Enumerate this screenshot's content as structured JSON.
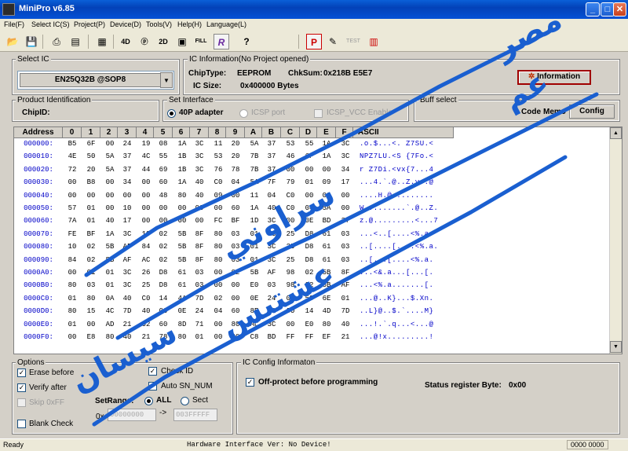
{
  "window": {
    "title": "MiniPro v6.85"
  },
  "menu": [
    "File(F)",
    "Select IC(S)",
    "Project(P)",
    "Device(D)",
    "Tools(V)",
    "Help(H)",
    "Language(L)"
  ],
  "select_ic": {
    "label": "Select IC",
    "chip": "EN25Q32B @SOP8"
  },
  "ic_info": {
    "label": "IC Information(No Project opened)",
    "chiptype_label": "ChipType:",
    "chiptype": "EEPROM",
    "chksum_label": "ChkSum:",
    "chksum": "0x218B E5E7",
    "icsize_label": "IC Size:",
    "icsize": "0x400000 Bytes",
    "info_button": "Information"
  },
  "product_id": {
    "label": "Product Identification",
    "chipid_label": "ChipID:"
  },
  "interface": {
    "label": "Set Interface",
    "opt40p": "40P adapter",
    "icsp": "ICSP port",
    "icspvcc": "ICSP_VCC Enable"
  },
  "buff": {
    "label": "Buff select",
    "code": "Code",
    "memo": "Memo",
    "config": "Config"
  },
  "grid": {
    "headers": [
      "Address",
      "0",
      "1",
      "2",
      "3",
      "4",
      "5",
      "6",
      "7",
      "8",
      "9",
      "A",
      "B",
      "C",
      "D",
      "E",
      "F",
      "ASCII"
    ],
    "rows": [
      {
        "addr": "000000:",
        "bytes": [
          "B5",
          "6F",
          "00",
          "24",
          "19",
          "08",
          "1A",
          "3C",
          "11",
          "20",
          "5A",
          "37",
          "53",
          "55",
          "1A",
          "3C"
        ],
        "ascii": ".o.$...<. Z7SU.<"
      },
      {
        "addr": "000010:",
        "bytes": [
          "4E",
          "50",
          "5A",
          "37",
          "4C",
          "55",
          "1B",
          "3C",
          "53",
          "20",
          "7B",
          "37",
          "46",
          "6F",
          "1A",
          "3C"
        ],
        "ascii": "NPZ7LU.<S {7Fo.<"
      },
      {
        "addr": "000020:",
        "bytes": [
          "72",
          "20",
          "5A",
          "37",
          "44",
          "69",
          "1B",
          "3C",
          "76",
          "78",
          "7B",
          "37",
          "00",
          "00",
          "00",
          "34"
        ],
        "ascii": "r Z7Di.<vx{7...4"
      },
      {
        "addr": "000030:",
        "bytes": [
          "00",
          "B8",
          "00",
          "34",
          "00",
          "60",
          "1A",
          "40",
          "C0",
          "04",
          "5A",
          "7F",
          "79",
          "01",
          "09",
          "17"
        ],
        "ascii": "...4.`.@..Z.y..@"
      },
      {
        "addr": "000040:",
        "bytes": [
          "00",
          "00",
          "00",
          "00",
          "00",
          "48",
          "80",
          "40",
          "09",
          "00",
          "11",
          "04",
          "C0",
          "00",
          "00",
          "00"
        ],
        "ascii": "....H.@........."
      },
      {
        "addr": "000050:",
        "bytes": [
          "57",
          "01",
          "00",
          "10",
          "00",
          "00",
          "00",
          "00",
          "00",
          "60",
          "1A",
          "40",
          "C0",
          "04",
          "5A",
          "00"
        ],
        "ascii": "W.........`.@..Z."
      },
      {
        "addr": "000060:",
        "bytes": [
          "7A",
          "01",
          "40",
          "17",
          "00",
          "00",
          "00",
          "00",
          "FC",
          "BF",
          "1D",
          "3C",
          "00",
          "0E",
          "BD",
          "37"
        ],
        "ascii": "z.@.........<...7"
      },
      {
        "addr": "000070:",
        "bytes": [
          "FE",
          "BF",
          "1A",
          "3C",
          "10",
          "02",
          "5B",
          "8F",
          "80",
          "03",
          "01",
          "3C",
          "25",
          "D8",
          "61",
          "03"
        ],
        "ascii": "...<..[....<%.a."
      },
      {
        "addr": "000080:",
        "bytes": [
          "10",
          "02",
          "5B",
          "AF",
          "84",
          "02",
          "5B",
          "8F",
          "80",
          "03",
          "01",
          "3C",
          "25",
          "D8",
          "61",
          "03"
        ],
        "ascii": "..[....[....<%.a."
      },
      {
        "addr": "000090:",
        "bytes": [
          "84",
          "02",
          "5B",
          "AF",
          "AC",
          "02",
          "5B",
          "8F",
          "80",
          "03",
          "01",
          "3C",
          "25",
          "D8",
          "61",
          "03"
        ],
        "ascii": "..[...[....<%.a."
      },
      {
        "addr": "0000A0:",
        "bytes": [
          "00",
          "01",
          "01",
          "3C",
          "26",
          "D8",
          "61",
          "03",
          "00",
          "02",
          "5B",
          "AF",
          "98",
          "02",
          "5B",
          "8F"
        ],
        "ascii": "...<&.a...[...[."
      },
      {
        "addr": "0000B0:",
        "bytes": [
          "80",
          "03",
          "01",
          "3C",
          "25",
          "D8",
          "61",
          "03",
          "00",
          "00",
          "E0",
          "03",
          "98",
          "02",
          "5B",
          "AF"
        ],
        "ascii": "...<%.a.......[."
      },
      {
        "addr": "0000C0:",
        "bytes": [
          "01",
          "80",
          "0A",
          "40",
          "C0",
          "14",
          "4A",
          "7D",
          "02",
          "00",
          "0E",
          "24",
          "04",
          "58",
          "6E",
          "01"
        ],
        "ascii": "...@..K}...$.Xn."
      },
      {
        "addr": "0000D0:",
        "bytes": [
          "80",
          "15",
          "4C",
          "7D",
          "40",
          "00",
          "0E",
          "24",
          "04",
          "60",
          "8E",
          "01",
          "00",
          "14",
          "4D",
          "7D"
        ],
        "ascii": "..L}@..$.`....M}"
      },
      {
        "addr": "0000E0:",
        "bytes": [
          "01",
          "00",
          "AD",
          "21",
          "02",
          "60",
          "8D",
          "71",
          "00",
          "80",
          "AC",
          "3C",
          "00",
          "E0",
          "80",
          "40"
        ],
        "ascii": "...!.`.q...<...@"
      },
      {
        "addr": "0000F0:",
        "bytes": [
          "00",
          "E8",
          "80",
          "40",
          "21",
          "78",
          "80",
          "01",
          "00",
          "80",
          "C8",
          "BD",
          "FF",
          "FF",
          "EF",
          "21"
        ],
        "ascii": "...@!x.........!"
      }
    ]
  },
  "options": {
    "label": "Options",
    "erase": "Erase before",
    "verify": "Verify after",
    "skip": "Skip 0xFF",
    "blank": "Blank Check",
    "checkid": "Check ID",
    "autosn": "Auto SN_NUM",
    "setrange": "SetRange:",
    "all": "ALL",
    "sect": "Sect",
    "prefix": "0x",
    "from": "00000000",
    "arrow": "->",
    "to": "003FFFFF"
  },
  "icconfig": {
    "label": "IC Config Informaton",
    "offprotect": "Off-protect before programming",
    "status_label": "Status register Byte:",
    "status_val": "0x00"
  },
  "status": {
    "left": "Ready",
    "middle": "Hardware Interface Ver: No Device!",
    "right": "0000 0000"
  },
  "overlay": {
    "color": "#1a5fd0",
    "lines": [
      "مصر",
      "عم",
      "سراوني",
      "سيسان",
      "عشتيس"
    ]
  }
}
